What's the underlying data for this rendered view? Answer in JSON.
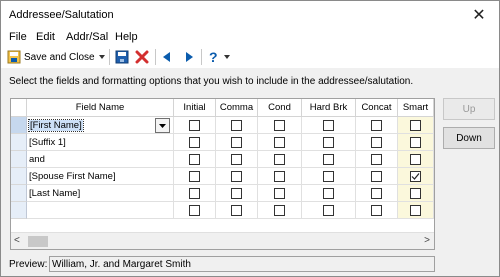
{
  "window": {
    "title": "Addressee/Salutation",
    "close_glyph": "✕"
  },
  "menu": [
    {
      "label": "File"
    },
    {
      "label": "Edit"
    },
    {
      "label": "Addr/Sal"
    },
    {
      "label": "Help"
    }
  ],
  "toolbar": {
    "save_close_label": "Save and Close",
    "icons": [
      "save-close-icon",
      "dropdown-caret-icon",
      "save-icon",
      "delete-icon",
      "previous-icon",
      "next-icon",
      "help-icon"
    ]
  },
  "instruction": "Select the fields and formatting options that you wish to include in the addressee/salutation.",
  "grid": {
    "columns": [
      "Field Name",
      "Initial",
      "Comma",
      "Cond",
      "Hard Brk",
      "Concat",
      "Smart"
    ],
    "rows": [
      {
        "field": "[First Name]",
        "selected": true,
        "checks": [
          false,
          false,
          false,
          false,
          false,
          false
        ]
      },
      {
        "field": "[Suffix 1]",
        "selected": false,
        "checks": [
          false,
          false,
          false,
          false,
          false,
          false
        ]
      },
      {
        "field": "and",
        "selected": false,
        "checks": [
          false,
          false,
          false,
          false,
          false,
          false
        ]
      },
      {
        "field": "[Spouse First Name]",
        "selected": false,
        "checks": [
          false,
          false,
          false,
          false,
          false,
          true
        ]
      },
      {
        "field": "[Last Name]",
        "selected": false,
        "checks": [
          false,
          false,
          false,
          false,
          false,
          false
        ]
      },
      {
        "field": "",
        "selected": false,
        "checks": [
          false,
          false,
          false,
          false,
          false,
          false
        ]
      }
    ]
  },
  "buttons": {
    "up": "Up",
    "down": "Down"
  },
  "preview": {
    "label": "Preview:",
    "value": "William, Jr. and Margaret Smith"
  },
  "colors": {
    "accent": "#0b5cad",
    "delete": "#d32f2f",
    "smart_column": "#fbf8dc",
    "selection": "#cde0f7"
  }
}
